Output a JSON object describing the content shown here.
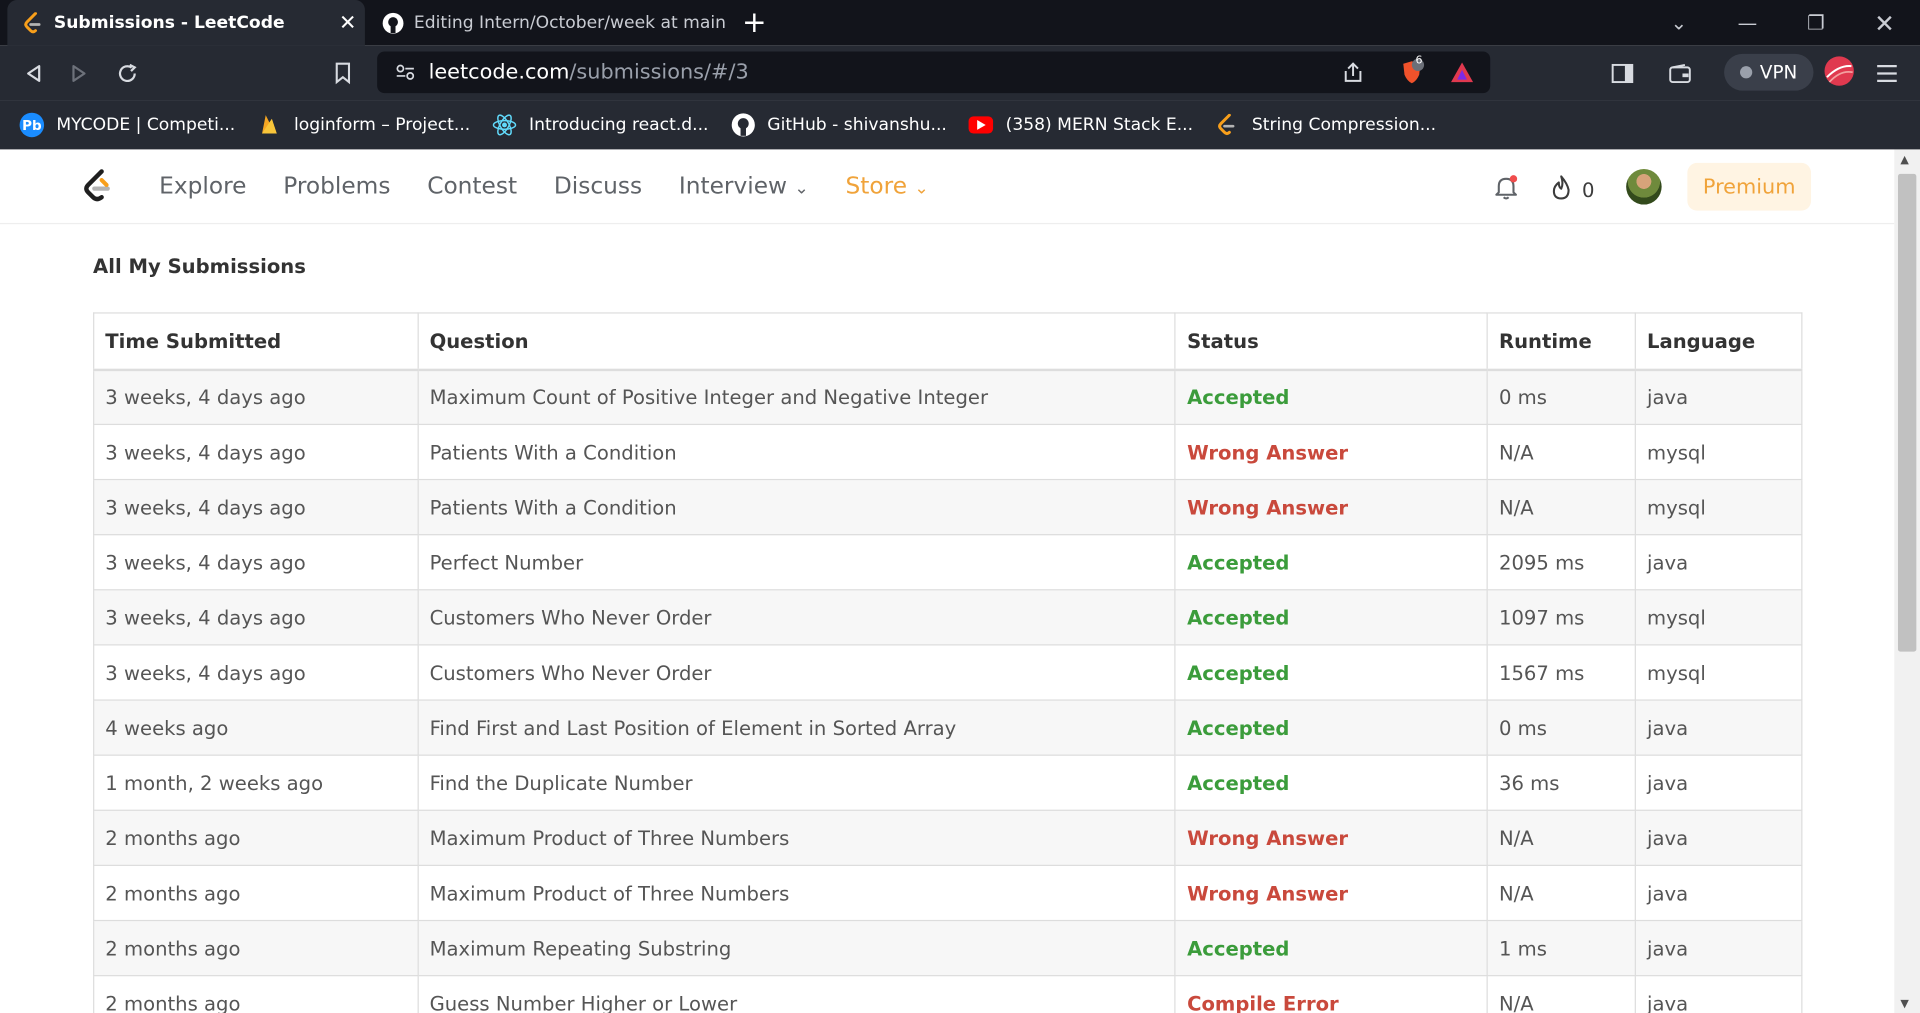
{
  "browser": {
    "tabs": [
      {
        "title": "Submissions - LeetCode",
        "active": true
      },
      {
        "title": "Editing Intern/October/week at main ·",
        "active": false
      }
    ],
    "url_host": "leetcode.com",
    "url_path": "/submissions/#/3",
    "vpn_label": "VPN",
    "brave_badge": "6",
    "bookmarks": [
      {
        "label": "MYCODE | Competi...",
        "icon": "pb-icon",
        "color": "#1a8cff"
      },
      {
        "label": "loginform – Project...",
        "icon": "firebase-icon",
        "color": "#f5a623"
      },
      {
        "label": "Introducing react.d...",
        "icon": "react-icon",
        "color": "#61dafb"
      },
      {
        "label": "GitHub - shivanshu...",
        "icon": "github-icon",
        "color": "#ffffff"
      },
      {
        "label": "(358) MERN Stack E...",
        "icon": "youtube-icon",
        "color": "#ff0000"
      },
      {
        "label": "String Compression...",
        "icon": "leetcode-icon",
        "color": "#f89f1b"
      }
    ]
  },
  "nav": {
    "links": [
      "Explore",
      "Problems",
      "Contest",
      "Discuss",
      "Interview"
    ],
    "store": "Store",
    "streak": "0",
    "premium": "Premium"
  },
  "page": {
    "title": "All My Submissions",
    "columns": [
      "Time Submitted",
      "Question",
      "Status",
      "Runtime",
      "Language"
    ],
    "rows": [
      {
        "time": "3 weeks, 4 days ago",
        "question": "Maximum Count of Positive Integer and Negative Integer",
        "status": "Accepted",
        "runtime": "0 ms",
        "language": "java"
      },
      {
        "time": "3 weeks, 4 days ago",
        "question": "Patients With a Condition",
        "status": "Wrong Answer",
        "runtime": "N/A",
        "language": "mysql"
      },
      {
        "time": "3 weeks, 4 days ago",
        "question": "Patients With a Condition",
        "status": "Wrong Answer",
        "runtime": "N/A",
        "language": "mysql"
      },
      {
        "time": "3 weeks, 4 days ago",
        "question": "Perfect Number",
        "status": "Accepted",
        "runtime": "2095 ms",
        "language": "java"
      },
      {
        "time": "3 weeks, 4 days ago",
        "question": "Customers Who Never Order",
        "status": "Accepted",
        "runtime": "1097 ms",
        "language": "mysql"
      },
      {
        "time": "3 weeks, 4 days ago",
        "question": "Customers Who Never Order",
        "status": "Accepted",
        "runtime": "1567 ms",
        "language": "mysql"
      },
      {
        "time": "4 weeks ago",
        "question": "Find First and Last Position of Element in Sorted Array",
        "status": "Accepted",
        "runtime": "0 ms",
        "language": "java"
      },
      {
        "time": "1 month, 2 weeks ago",
        "question": "Find the Duplicate Number",
        "status": "Accepted",
        "runtime": "36 ms",
        "language": "java"
      },
      {
        "time": "2 months ago",
        "question": "Maximum Product of Three Numbers",
        "status": "Wrong Answer",
        "runtime": "N/A",
        "language": "java"
      },
      {
        "time": "2 months ago",
        "question": "Maximum Product of Three Numbers",
        "status": "Wrong Answer",
        "runtime": "N/A",
        "language": "java"
      },
      {
        "time": "2 months ago",
        "question": "Maximum Repeating Substring",
        "status": "Accepted",
        "runtime": "1 ms",
        "language": "java"
      },
      {
        "time": "2 months ago",
        "question": "Guess Number Higher or Lower",
        "status": "Compile Error",
        "runtime": "N/A",
        "language": "java"
      }
    ]
  },
  "colors": {
    "accepted": "#3b9c3b",
    "error": "#c9493c",
    "accent": "#f0a33a"
  }
}
